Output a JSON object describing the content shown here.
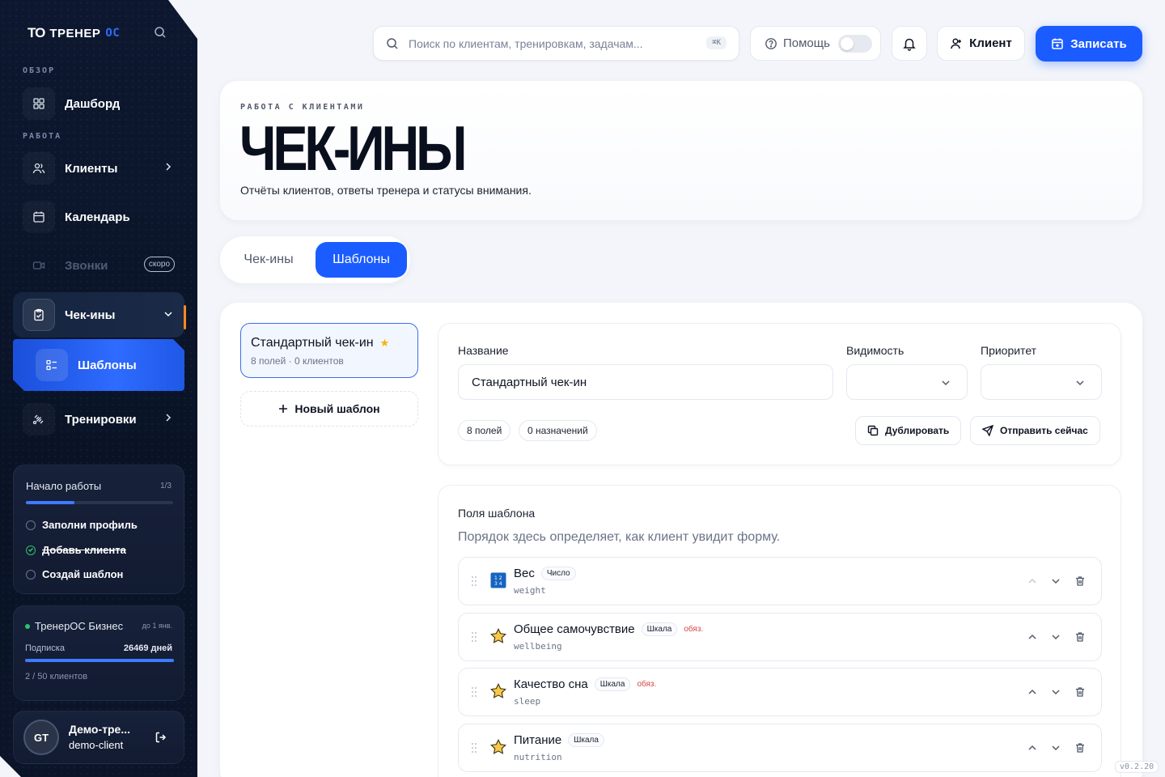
{
  "app": {
    "logo_mark": "TO",
    "logo_text": "ТРЕНЕР",
    "logo_accent": "ОС",
    "version": "v0.2.20"
  },
  "sidebar": {
    "section_overview": "ОБЗОР",
    "section_work": "РАБОТА",
    "items": [
      {
        "label": "Дашборд",
        "icon": "grid-icon"
      },
      {
        "label": "Клиенты",
        "icon": "users-icon"
      },
      {
        "label": "Календарь",
        "icon": "calendar-icon"
      },
      {
        "label": "Звонки",
        "icon": "video-icon",
        "badge": "скоро"
      },
      {
        "label": "Чек-ины",
        "icon": "clipboard-icon"
      },
      {
        "label": "Шаблоны",
        "icon": "list-icon"
      },
      {
        "label": "Тренировки",
        "icon": "dumbbell-icon"
      }
    ],
    "onboarding": {
      "title": "Начало работы",
      "count": "1/3",
      "progress": 0.33,
      "tasks": [
        {
          "label": "Заполни профиль",
          "done": false
        },
        {
          "label": "Добавь клиента",
          "done": true
        },
        {
          "label": "Создай шаблон",
          "done": false
        }
      ]
    },
    "plan": {
      "name": "ТренерОС Бизнес",
      "until": "до 1 янв.",
      "subscription_label": "Подписка",
      "days": "26469 дней",
      "progress": 1.0,
      "clients": "2 / 50 клиентов"
    },
    "user": {
      "initials": "GT",
      "name": "Демо-тре...",
      "sub": "demo-client"
    }
  },
  "topbar": {
    "search_placeholder": "Поиск по клиентам, тренировкам, задачам...",
    "search_shortcut": "⌘K",
    "help_label": "Помощь",
    "client_label": "Клиент",
    "book_label": "Записать"
  },
  "hero": {
    "eyebrow": "РАБОТА С КЛИЕНТАМИ",
    "title": "ЧЕК-ИНЫ",
    "subtitle": "Отчёты клиентов, ответы тренера и статусы внимания."
  },
  "tabs": {
    "checkins": "Чек-ины",
    "templates": "Шаблоны"
  },
  "templates_list": {
    "active": {
      "name": "Стандартный чек-ин",
      "meta": "8 полей · 0 клиентов"
    },
    "new_label": "Новый шаблон"
  },
  "form": {
    "name_label": "Название",
    "name_value": "Стандартный чек-ин",
    "visibility_label": "Видимость",
    "priority_label": "Приоритет",
    "fields_count": "8 полей",
    "assignments": "0 назначений",
    "duplicate_label": "Дублировать",
    "send_label": "Отправить сейчас"
  },
  "fields_section": {
    "title": "Поля шаблона",
    "subtitle": "Порядок здесь определяет, как клиент увидит форму.",
    "rows": [
      {
        "name": "Вес",
        "type": "Число",
        "required": "",
        "key": "weight",
        "icon": "number-icon"
      },
      {
        "name": "Общее самочувствие",
        "type": "Шкала",
        "required": "обяз.",
        "key": "wellbeing",
        "icon": "star-icon"
      },
      {
        "name": "Качество сна",
        "type": "Шкала",
        "required": "обяз.",
        "key": "sleep",
        "icon": "star-icon"
      },
      {
        "name": "Питание",
        "type": "Шкала",
        "required": "",
        "key": "nutrition",
        "icon": "star-icon"
      }
    ]
  }
}
